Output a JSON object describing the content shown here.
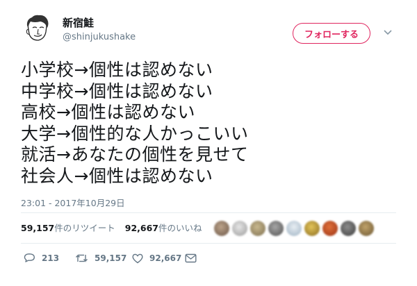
{
  "author": {
    "name": "新宿鮭",
    "handle": "@shinjukushake"
  },
  "follow_label": "フォローする",
  "tweet": {
    "lines": [
      "小学校→個性は認めない",
      "中学校→個性は認めない",
      "高校→個性は認めない",
      "大学→個性的な人かっこいい",
      "就活→あなたの個性を見せて",
      "社会人→個性は認めない"
    ],
    "timestamp": "23:01 - 2017年10月29日"
  },
  "stats": {
    "retweets_count": "59,157",
    "retweets_label": "件のリツイート",
    "likes_count": "92,667",
    "likes_label": "件のいいね"
  },
  "actions": {
    "reply_count": "213",
    "retweet_count": "59,157",
    "like_count": "92,667"
  },
  "colors": {
    "accent": "#e0245e",
    "secondary_text": "#657786",
    "divider": "#e6ecf0"
  }
}
